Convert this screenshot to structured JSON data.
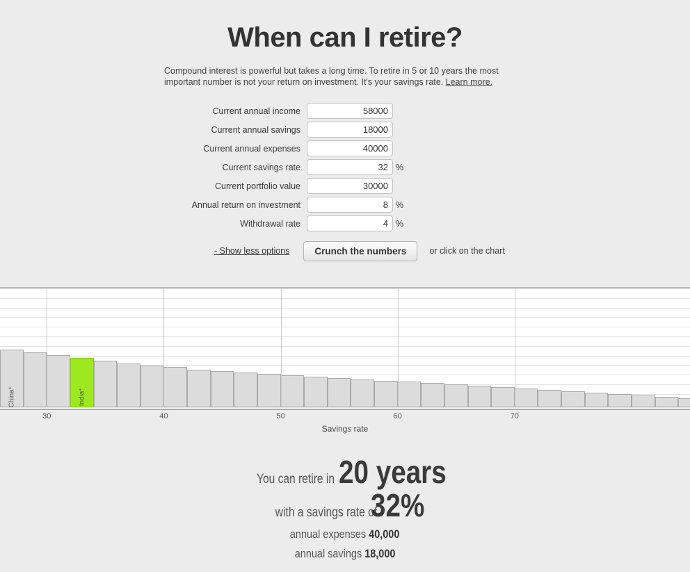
{
  "header": {
    "title": "When can I retire?",
    "subtitle_text": "Compound interest is powerful but takes a long time. To retire in 5 or 10 years the most important number is not your return on investment. It's your savings rate. ",
    "learn_more_label": "Learn more."
  },
  "form": {
    "rows": [
      {
        "label": "Current annual income",
        "value": "58000",
        "suffix": ""
      },
      {
        "label": "Current annual savings",
        "value": "18000",
        "suffix": ""
      },
      {
        "label": "Current annual expenses",
        "value": "40000",
        "suffix": ""
      },
      {
        "label": "Current savings rate",
        "value": "32",
        "suffix": "%"
      },
      {
        "label": "Current portfolio value",
        "value": "30000",
        "suffix": ""
      },
      {
        "label": "Annual return on investment",
        "value": "8",
        "suffix": "%"
      },
      {
        "label": "Withdrawal rate",
        "value": "4",
        "suffix": "%"
      }
    ]
  },
  "actions": {
    "show_less_label": "- Show less options",
    "crunch_label": "Crunch the numbers",
    "chart_hint": "or click on the chart"
  },
  "chart_data": {
    "type": "bar",
    "title": "",
    "xlabel": "Savings rate",
    "ylabel": "",
    "xlim": [
      26,
      85
    ],
    "xticks": [
      30,
      40,
      50,
      60,
      70
    ],
    "grid": true,
    "legend": null,
    "highlight_category": 32,
    "highlight_color": "#9ee820",
    "bar_color": "#dcdcdc",
    "annotations": [
      {
        "category": 26,
        "label": "China*"
      },
      {
        "category": 32,
        "label": "India*"
      }
    ],
    "categories": [
      26,
      28,
      30,
      32,
      34,
      36,
      38,
      40,
      42,
      44,
      46,
      48,
      50,
      52,
      54,
      56,
      58,
      60,
      62,
      64,
      66,
      68,
      70,
      72,
      74,
      76,
      78,
      80,
      82,
      84
    ],
    "values": [
      43,
      41,
      39,
      37,
      35,
      33,
      31,
      30,
      28,
      27,
      26,
      25,
      24,
      23,
      22,
      21,
      20,
      19,
      18,
      17,
      16,
      15,
      14,
      13,
      12,
      11,
      10,
      9,
      8,
      7
    ],
    "ylim": [
      0,
      90
    ]
  },
  "results": {
    "retire_prefix": "You can retire in",
    "retire_value": "20 years",
    "rate_prefix": "with a savings rate of",
    "rate_value": "32%",
    "expenses_label": "annual expenses",
    "expenses_value": "40,000",
    "savings_label": "annual savings",
    "savings_value": "18,000"
  }
}
